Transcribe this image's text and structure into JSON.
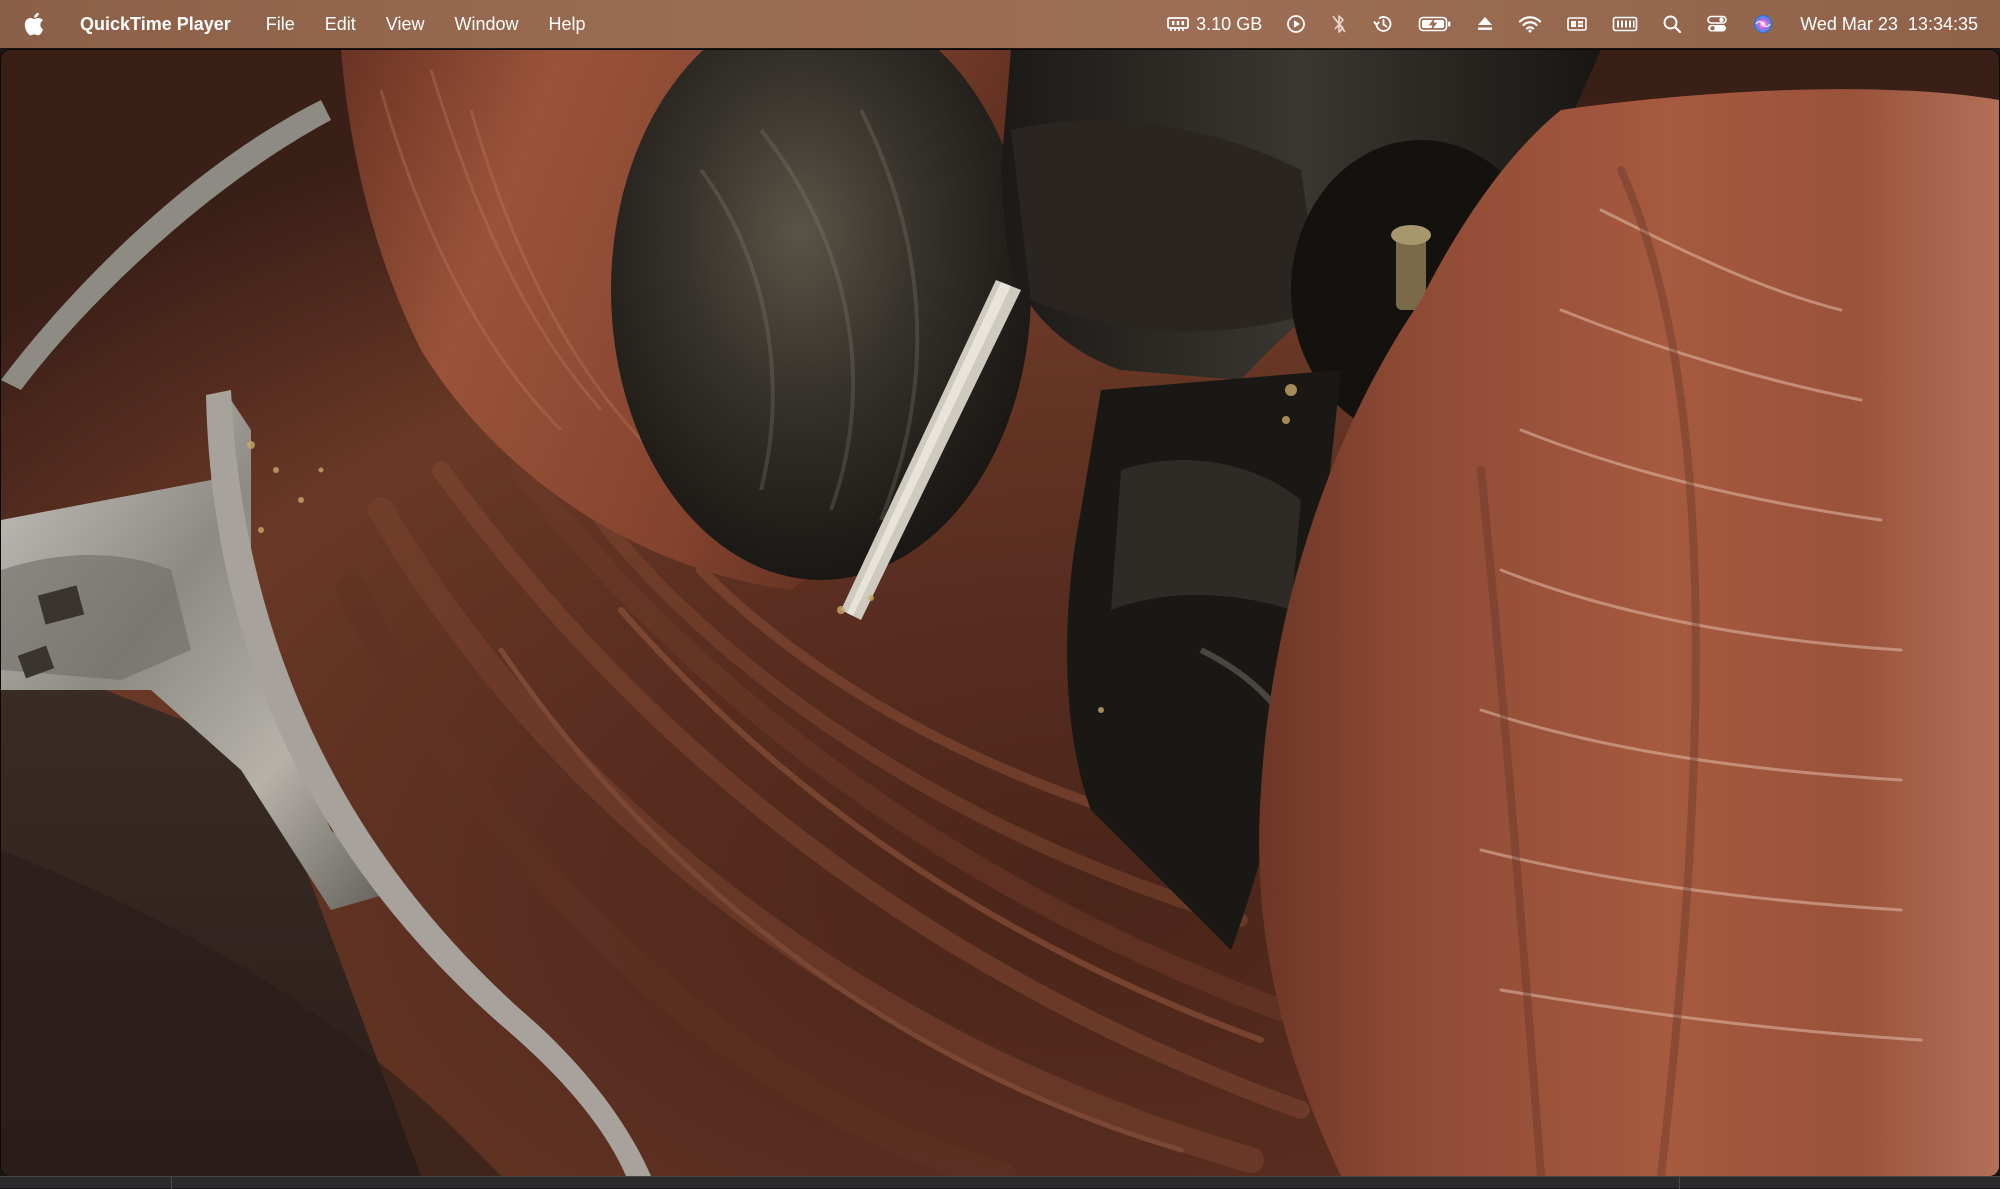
{
  "menubar": {
    "app_name": "QuickTime Player",
    "menus": [
      "File",
      "Edit",
      "View",
      "Window",
      "Help"
    ],
    "status": {
      "memory_text": "3.10 GB",
      "icons": [
        "memory-icon",
        "play-circle-icon",
        "bluetooth-off-icon",
        "time-machine-icon",
        "battery-charging-icon",
        "eject-icon",
        "wifi-icon",
        "display-icon",
        "keyboard-icon",
        "spotlight-search-icon",
        "control-center-icon",
        "siri-icon"
      ]
    },
    "clock": {
      "date": "Wed Mar 23",
      "time": "13:34:35"
    }
  },
  "video": {
    "description_icon": "video-frame"
  },
  "colors": {
    "menubar_bg": "#9a6c52",
    "menubar_text": "#ffffff",
    "roller_main": "#8a4a36",
    "chocolate_dark": "#3a1f17"
  }
}
